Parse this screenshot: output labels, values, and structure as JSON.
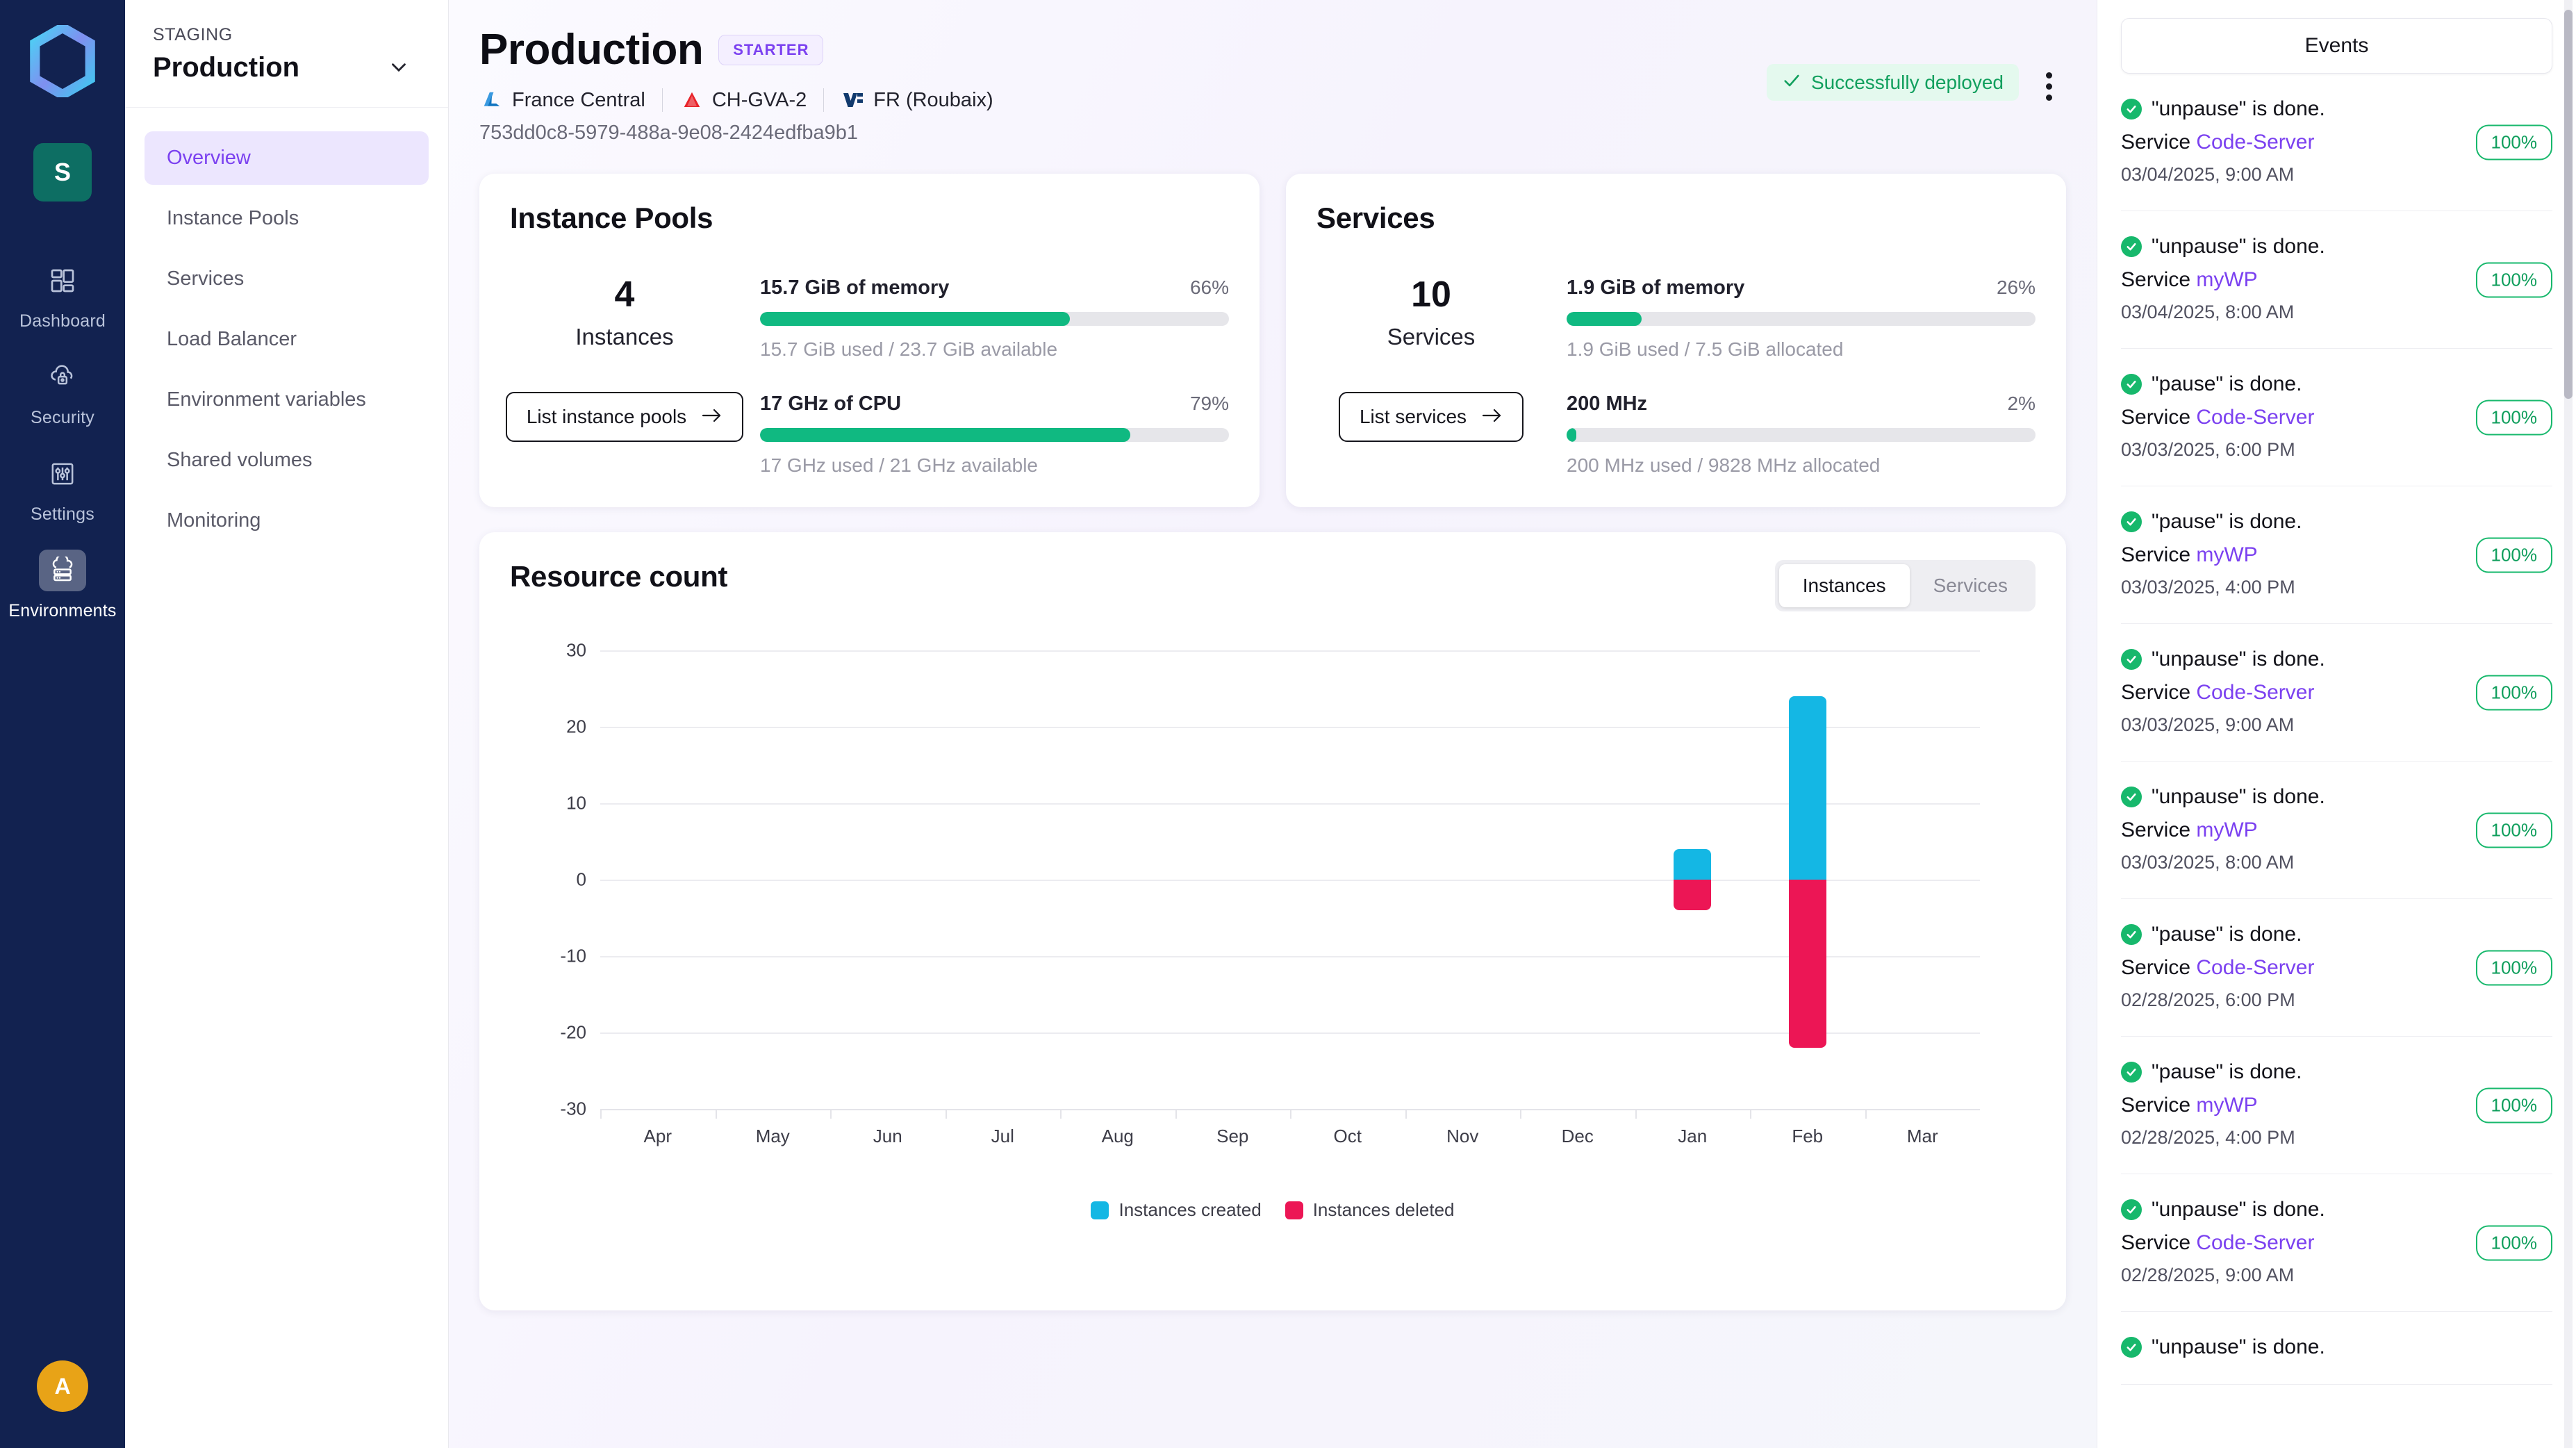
{
  "rail": {
    "org_initial": "S",
    "user_initial": "A",
    "items": [
      {
        "label": "Dashboard",
        "icon": "dashboard-icon",
        "active": false
      },
      {
        "label": "Security",
        "icon": "cloud-lock-icon",
        "active": false
      },
      {
        "label": "Settings",
        "icon": "sliders-icon",
        "active": false
      },
      {
        "label": "Environments",
        "icon": "cloud-server-icon",
        "active": true
      }
    ]
  },
  "envbar": {
    "staging_label": "STAGING",
    "env_name": "Production",
    "menu": [
      {
        "label": "Overview",
        "active": true
      },
      {
        "label": "Instance Pools",
        "active": false
      },
      {
        "label": "Services",
        "active": false
      },
      {
        "label": "Load Balancer",
        "active": false
      },
      {
        "label": "Environment variables",
        "active": false
      },
      {
        "label": "Shared volumes",
        "active": false
      },
      {
        "label": "Monitoring",
        "active": false
      }
    ]
  },
  "header": {
    "title": "Production",
    "plan_badge": "STARTER",
    "regions": [
      {
        "name": "France Central",
        "icon": "azure-icon"
      },
      {
        "name": "CH-GVA-2",
        "icon": "exoscale-icon"
      },
      {
        "name": "FR (Roubaix)",
        "icon": "ovh-icon"
      }
    ],
    "uuid": "753dd0c8-5979-488a-9e08-2424edfba9b1",
    "deploy_status": "Successfully deployed",
    "status_color": "#12a05e"
  },
  "cards": [
    {
      "title": "Instance Pools",
      "count": "4",
      "count_label": "Instances",
      "button": "List instance pools",
      "metrics": [
        {
          "name": "15.7 GiB of memory",
          "pct_label": "66%",
          "pct": 66,
          "sub": "15.7 GiB used / 23.7 GiB available"
        },
        {
          "name": "17 GHz of CPU",
          "pct_label": "79%",
          "pct": 79,
          "sub": "17 GHz used / 21 GHz available"
        }
      ]
    },
    {
      "title": "Services",
      "count": "10",
      "count_label": "Services",
      "button": "List services",
      "metrics": [
        {
          "name": "1.9 GiB of memory",
          "pct_label": "26%",
          "pct": 16,
          "sub": "1.9 GiB used / 7.5 GiB allocated"
        },
        {
          "name": "200 MHz",
          "pct_label": "2%",
          "pct": 2,
          "sub": "200 MHz used / 9828 MHz allocated"
        }
      ]
    }
  ],
  "chart_panel": {
    "title": "Resource count",
    "tabs": [
      {
        "label": "Instances",
        "active": true
      },
      {
        "label": "Services",
        "active": false
      }
    ]
  },
  "chart_data": {
    "type": "bar",
    "title": "Resource count",
    "xlabel": "",
    "ylabel": "",
    "categories": [
      "Apr",
      "May",
      "Jun",
      "Jul",
      "Aug",
      "Sep",
      "Oct",
      "Nov",
      "Dec",
      "Jan",
      "Feb",
      "Mar"
    ],
    "yticks": [
      30,
      20,
      10,
      0,
      -10,
      -20,
      -30
    ],
    "ylim": [
      -30,
      30
    ],
    "grid": true,
    "legend_position": "bottom",
    "stacked_diverging": true,
    "series": [
      {
        "name": "Instances created",
        "color": "#14b7e4",
        "values": [
          0,
          0,
          0,
          0,
          0,
          0,
          0,
          0,
          0,
          4,
          24,
          0
        ]
      },
      {
        "name": "Instances deleted",
        "color": "#ec1655",
        "values": [
          0,
          0,
          0,
          0,
          0,
          0,
          0,
          0,
          0,
          -4,
          -22,
          0
        ]
      }
    ]
  },
  "events": {
    "tab_label": "Events",
    "items": [
      {
        "action": "\"unpause\" is done.",
        "service_prefix": "Service ",
        "service": "Code-Server",
        "time": "03/04/2025, 9:00 AM",
        "pct": "100%"
      },
      {
        "action": "\"unpause\" is done.",
        "service_prefix": "Service ",
        "service": "myWP",
        "time": "03/04/2025, 8:00 AM",
        "pct": "100%"
      },
      {
        "action": "\"pause\" is done.",
        "service_prefix": "Service ",
        "service": "Code-Server",
        "time": "03/03/2025, 6:00 PM",
        "pct": "100%"
      },
      {
        "action": "\"pause\" is done.",
        "service_prefix": "Service ",
        "service": "myWP",
        "time": "03/03/2025, 4:00 PM",
        "pct": "100%"
      },
      {
        "action": "\"unpause\" is done.",
        "service_prefix": "Service ",
        "service": "Code-Server",
        "time": "03/03/2025, 9:00 AM",
        "pct": "100%"
      },
      {
        "action": "\"unpause\" is done.",
        "service_prefix": "Service ",
        "service": "myWP",
        "time": "03/03/2025, 8:00 AM",
        "pct": "100%"
      },
      {
        "action": "\"pause\" is done.",
        "service_prefix": "Service ",
        "service": "Code-Server",
        "time": "02/28/2025, 6:00 PM",
        "pct": "100%"
      },
      {
        "action": "\"pause\" is done.",
        "service_prefix": "Service ",
        "service": "myWP",
        "time": "02/28/2025, 4:00 PM",
        "pct": "100%"
      },
      {
        "action": "\"unpause\" is done.",
        "service_prefix": "Service ",
        "service": "Code-Server",
        "time": "02/28/2025, 9:00 AM",
        "pct": "100%"
      },
      {
        "action": "\"unpause\" is done.",
        "service_prefix": "Service ",
        "service": "",
        "time": "",
        "pct": ""
      }
    ]
  }
}
